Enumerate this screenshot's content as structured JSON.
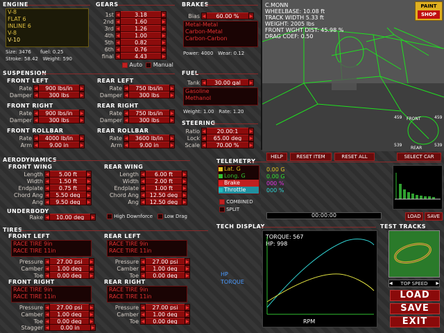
{
  "engine": {
    "title": "ENGINE",
    "list": [
      "V-8",
      "FLAT 6",
      "INLINE 6",
      "V-8",
      "V-10"
    ],
    "selected": 4,
    "size_lbl": "Size:",
    "size": "3476",
    "fuel_lbl": "fuel:",
    "fuel": "0.25",
    "stroke_lbl": "Stroke:",
    "stroke": "58.42",
    "weight_lbl": "Weight:",
    "weight": "590"
  },
  "gears": {
    "title": "GEARS",
    "rows": [
      {
        "l": "1st",
        "v": "3.18"
      },
      {
        "l": "2nd",
        "v": "1.60"
      },
      {
        "l": "3rd",
        "v": "1.26"
      },
      {
        "l": "4th",
        "v": "1.00"
      },
      {
        "l": "5th",
        "v": "0.82"
      },
      {
        "l": "6th",
        "v": "0.76"
      },
      {
        "l": "final",
        "v": "4.43"
      }
    ],
    "auto": "Auto",
    "manual": "Manual"
  },
  "brakes": {
    "title": "BRAKES",
    "bias_lbl": "Bias",
    "bias": "60.00 %",
    "list": [
      "Metal-Metal",
      "Carbon-Metal",
      "Carbon-Carbon"
    ],
    "power_lbl": "Power:",
    "power": "4000",
    "wear_lbl": "Wear:",
    "wear": "0.12"
  },
  "viewport": {
    "info": [
      "C.MONN",
      "WHEELBASE: 10.08 ft",
      "TRACK WIDTH 5.33 ft",
      "WEIGHT: 2005 lbs",
      "FRONT WGHT DIST: 45.98 %",
      "DRAG COEF: 0.50"
    ],
    "paint": "PAINT",
    "shop": "SHOP",
    "front": "FRONT",
    "rear": "REAR",
    "t_fl": "459",
    "t_fr": "459",
    "t_rl": "539",
    "t_rr": "539",
    "help": "HELP",
    "reset_item": "RESET ITEM",
    "reset_all": "RESET ALL",
    "select_car": "SELECT CAR"
  },
  "suspension": {
    "title": "SUSPENSION",
    "fl": {
      "title": "FRONT LEFT",
      "rate_lbl": "Rate",
      "rate": "900 lbs/in",
      "damp_lbl": "Damper",
      "damp": "300 lbs"
    },
    "rl": {
      "title": "REAR LEFT",
      "rate_lbl": "Rate",
      "rate": "750 lbs/in",
      "damp_lbl": "Damper",
      "damp": "300 lbs"
    },
    "fr": {
      "title": "FRONT RIGHT",
      "rate_lbl": "Rate",
      "rate": "900 lbs/in",
      "damp_lbl": "Damper",
      "damp": "300 lbs"
    },
    "rr": {
      "title": "REAR RIGHT",
      "rate_lbl": "Rate",
      "rate": "750 lbs/in",
      "damp_lbl": "Damper",
      "damp": "300 lbs"
    },
    "frb": {
      "title": "FRONT ROLLBAR",
      "rate_lbl": "Rate",
      "rate": "4000 lb/in",
      "arm_lbl": "Arm",
      "arm": "9.00 in"
    },
    "rrb": {
      "title": "REAR ROLLBAR",
      "rate_lbl": "Rate",
      "rate": "3600 lb/in",
      "arm_lbl": "Arm",
      "arm": "9.00 in"
    }
  },
  "fuel": {
    "title": "FUEL",
    "tank_lbl": "Tank",
    "tank": "30.00 gal",
    "list": [
      "Gasoline",
      "Methanol"
    ],
    "weight_lbl": "Weight:",
    "weight": "1.00",
    "rate_lbl": "Rate:",
    "rate": "1.20"
  },
  "steering": {
    "title": "STEERING",
    "ratio_lbl": "Ratio",
    "ratio": "20.00:1",
    "lock_lbl": "Lock",
    "lock": "65.00 deg",
    "scale_lbl": "Scale",
    "scale": "70.00 %"
  },
  "aero": {
    "title": "AERODYNAMICS",
    "fw": {
      "title": "FRONT WING",
      "length_lbl": "Length",
      "length": "5.00 ft",
      "width_lbl": "Width",
      "width": "1.50 ft",
      "end_lbl": "Endplate",
      "end": "0.75 ft",
      "chord_lbl": "Chord Ang",
      "chord": "5.50 deg",
      "ang_lbl": "Ang",
      "ang": "9.50 deg"
    },
    "rw": {
      "title": "REAR WING",
      "length_lbl": "Length",
      "length": "6.00 ft",
      "width_lbl": "Width",
      "width": "2.00 ft",
      "end_lbl": "Endplate",
      "end": "1.00 ft",
      "chord_lbl": "Chord Ang",
      "chord": "12.50 deg",
      "ang_lbl": "Ang",
      "ang": "12.50 deg"
    },
    "ub": {
      "title": "UNDERBODY",
      "rake_lbl": "Rake",
      "rake": "10.00 deg",
      "high_df": "High Downforce",
      "low_drag": "Low Drag"
    }
  },
  "telemetry": {
    "title": "TELEMETRY",
    "items": [
      {
        "l": "Lat. G",
        "c": "#e0c020"
      },
      {
        "l": "Long. G",
        "c": "#30c030"
      },
      {
        "l": "Brake",
        "c": "#e02020"
      },
      {
        "l": "Throttle",
        "c": "#20c0c0"
      }
    ],
    "vals": [
      {
        "v": "0.00 G",
        "c": "#e0c020"
      },
      {
        "v": "0.00 G",
        "c": "#30e030"
      },
      {
        "v": "000 %",
        "c": "#e030e0"
      },
      {
        "v": "000 %",
        "c": "#30d0d0"
      }
    ],
    "combined": "COMBINED",
    "split": "SPLIT",
    "time": "00:00:00",
    "load": "LOAD",
    "save": "SAVE"
  },
  "tires": {
    "title": "TIRES",
    "fl": {
      "title": "FRONT LEFT",
      "list": [
        "RACE TIRE 9in",
        "RACE TIRE 11in"
      ],
      "pres_lbl": "Pressure",
      "pres": "27.00 psi",
      "camb_lbl": "Camber",
      "camb": "1.00 deg",
      "toe_lbl": "Toe",
      "toe": "0.00 deg"
    },
    "rl": {
      "title": "REAR LEFT",
      "list": [
        "RACE TIRE 9in",
        "RACE TIRE 11in"
      ],
      "pres_lbl": "Pressure",
      "pres": "27.00 psi",
      "camb_lbl": "Camber",
      "camb": "1.00 deg",
      "toe_lbl": "Toe",
      "toe": "0.00 deg"
    },
    "fr": {
      "title": "FRONT RIGHT",
      "list": [
        "RACE TIRE 9in",
        "RACE TIRE 11in"
      ],
      "pres_lbl": "Pressure",
      "pres": "27.00 psi",
      "camb_lbl": "Camber",
      "camb": "1.00 deg",
      "toe_lbl": "Toe",
      "toe": "0.00 deg"
    },
    "rr": {
      "title": "REAR RIGHT",
      "list": [
        "RACE TIRE 9in",
        "RACE TIRE 11in"
      ],
      "pres_lbl": "Pressure",
      "pres": "27.00 psi",
      "camb_lbl": "Camber",
      "camb": "1.00 deg",
      "toe_lbl": "Toe",
      "toe": "0.00 deg"
    },
    "stagger_lbl": "Stagger",
    "stagger": "0.00 in"
  },
  "tech": {
    "title": "TECH DISPLAY",
    "torque": "TORQUE: 567",
    "hp": "HP: 998",
    "hp_lbl": "HP",
    "torque_lbl": "TORQUE",
    "rpm": "RPM"
  },
  "tracks": {
    "title": "TEST TRACKS",
    "top_speed": "TOP SPEED",
    "load": "LOAD",
    "save": "SAVE",
    "exit": "EXIT"
  }
}
